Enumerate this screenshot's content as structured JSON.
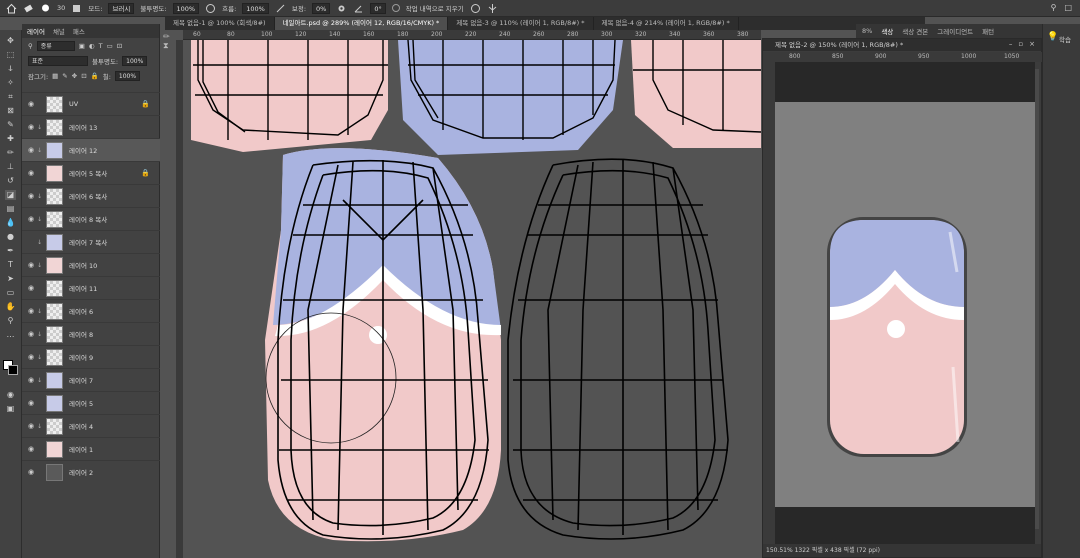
{
  "options_bar": {
    "mode_label": "모드:",
    "mode_value": "브러시",
    "opacity_label": "불투명도:",
    "opacity_value": "100%",
    "flow_label": "흐름:",
    "flow_value": "100%",
    "smoothing_label": "보정:",
    "smoothing_value": "0%",
    "angle_value": "0°",
    "brush_size": "30",
    "erase_history_label": "작업 내역으로 지우기"
  },
  "tabs": [
    {
      "label": "제목 없음-1 @ 100% (회색/8#)",
      "active": false
    },
    {
      "label": "네일아트.psd @ 289% (레이어 12, RGB/16/CMYK) *",
      "active": true
    },
    {
      "label": "제목 없음-3 @ 110% (레이어 1, RGB/8#) *",
      "active": false
    },
    {
      "label": "제목 없음-4 @ 214% (레이어 1, RGB/8#) *",
      "active": false
    }
  ],
  "layers_panel": {
    "tabs": [
      "레이어",
      "채널",
      "패스"
    ],
    "filter_label": "종류",
    "blend_mode": "표준",
    "opacity_label": "불투명도:",
    "opacity_value": "100%",
    "lock_label": "잠그기:",
    "fill_label": "칠:",
    "fill_value": "100%",
    "layers": [
      {
        "name": "UV",
        "visible": true,
        "active": false,
        "locked": true,
        "clip": false,
        "thumb": "checker"
      },
      {
        "name": "레이어 13",
        "visible": true,
        "active": false,
        "locked": false,
        "clip": true,
        "thumb": "checker"
      },
      {
        "name": "레이어 12",
        "visible": true,
        "active": true,
        "locked": false,
        "clip": true,
        "thumb": "blue"
      },
      {
        "name": "레이어 5 복사",
        "visible": true,
        "active": false,
        "locked": true,
        "clip": false,
        "thumb": "pink"
      },
      {
        "name": "레이어 6 복사",
        "visible": true,
        "active": false,
        "locked": false,
        "clip": true,
        "thumb": "checker"
      },
      {
        "name": "레이어 8 복사",
        "visible": true,
        "active": false,
        "locked": false,
        "clip": true,
        "thumb": "checker"
      },
      {
        "name": "레이어 7 복사",
        "visible": false,
        "active": false,
        "locked": false,
        "clip": true,
        "thumb": "blue"
      },
      {
        "name": "레이어 10",
        "visible": true,
        "active": false,
        "locked": false,
        "clip": true,
        "thumb": "pink"
      },
      {
        "name": "레이어 11",
        "visible": true,
        "active": false,
        "locked": false,
        "clip": false,
        "thumb": "checker"
      },
      {
        "name": "레이어 6",
        "visible": true,
        "active": false,
        "locked": false,
        "clip": true,
        "thumb": "checker"
      },
      {
        "name": "레이어 8",
        "visible": true,
        "active": false,
        "locked": false,
        "clip": true,
        "thumb": "checker"
      },
      {
        "name": "레이어 9",
        "visible": true,
        "active": false,
        "locked": false,
        "clip": true,
        "thumb": "checker"
      },
      {
        "name": "레이어 7",
        "visible": true,
        "active": false,
        "locked": false,
        "clip": true,
        "thumb": "blue"
      },
      {
        "name": "레이어 5",
        "visible": true,
        "active": false,
        "locked": false,
        "clip": false,
        "thumb": "blue"
      },
      {
        "name": "레이어 4",
        "visible": true,
        "active": false,
        "locked": false,
        "clip": true,
        "thumb": "checker"
      },
      {
        "name": "레이어 1",
        "visible": true,
        "active": false,
        "locked": false,
        "clip": false,
        "thumb": "pink"
      },
      {
        "name": "레이어 2",
        "visible": true,
        "active": false,
        "locked": false,
        "clip": false,
        "thumb": "gray"
      }
    ]
  },
  "ruler_top_labels": [
    "60",
    "80",
    "100",
    "120",
    "140",
    "160",
    "180",
    "200",
    "220",
    "240",
    "260",
    "280",
    "300",
    "320",
    "340",
    "360",
    "380"
  ],
  "float_window": {
    "title": "제목 없음-2 @ 150% (레이어 1, RGB/8#) *",
    "ruler_labels": [
      "800",
      "850",
      "900",
      "950",
      "1000",
      "1050"
    ],
    "status": "150.51%    1322 픽셀 x 438 픽셀 (72 ppi)"
  },
  "right_panel_tabs": [
    "8%",
    "색상",
    "색상 견본",
    "그레이디언트",
    "패턴"
  ],
  "far_right_label": "학습",
  "colors": {
    "nail_pink": "#f1c9c9",
    "nail_blue": "#a9b3e0",
    "canvas_bg": "#535353",
    "panel_bg": "#424242"
  }
}
